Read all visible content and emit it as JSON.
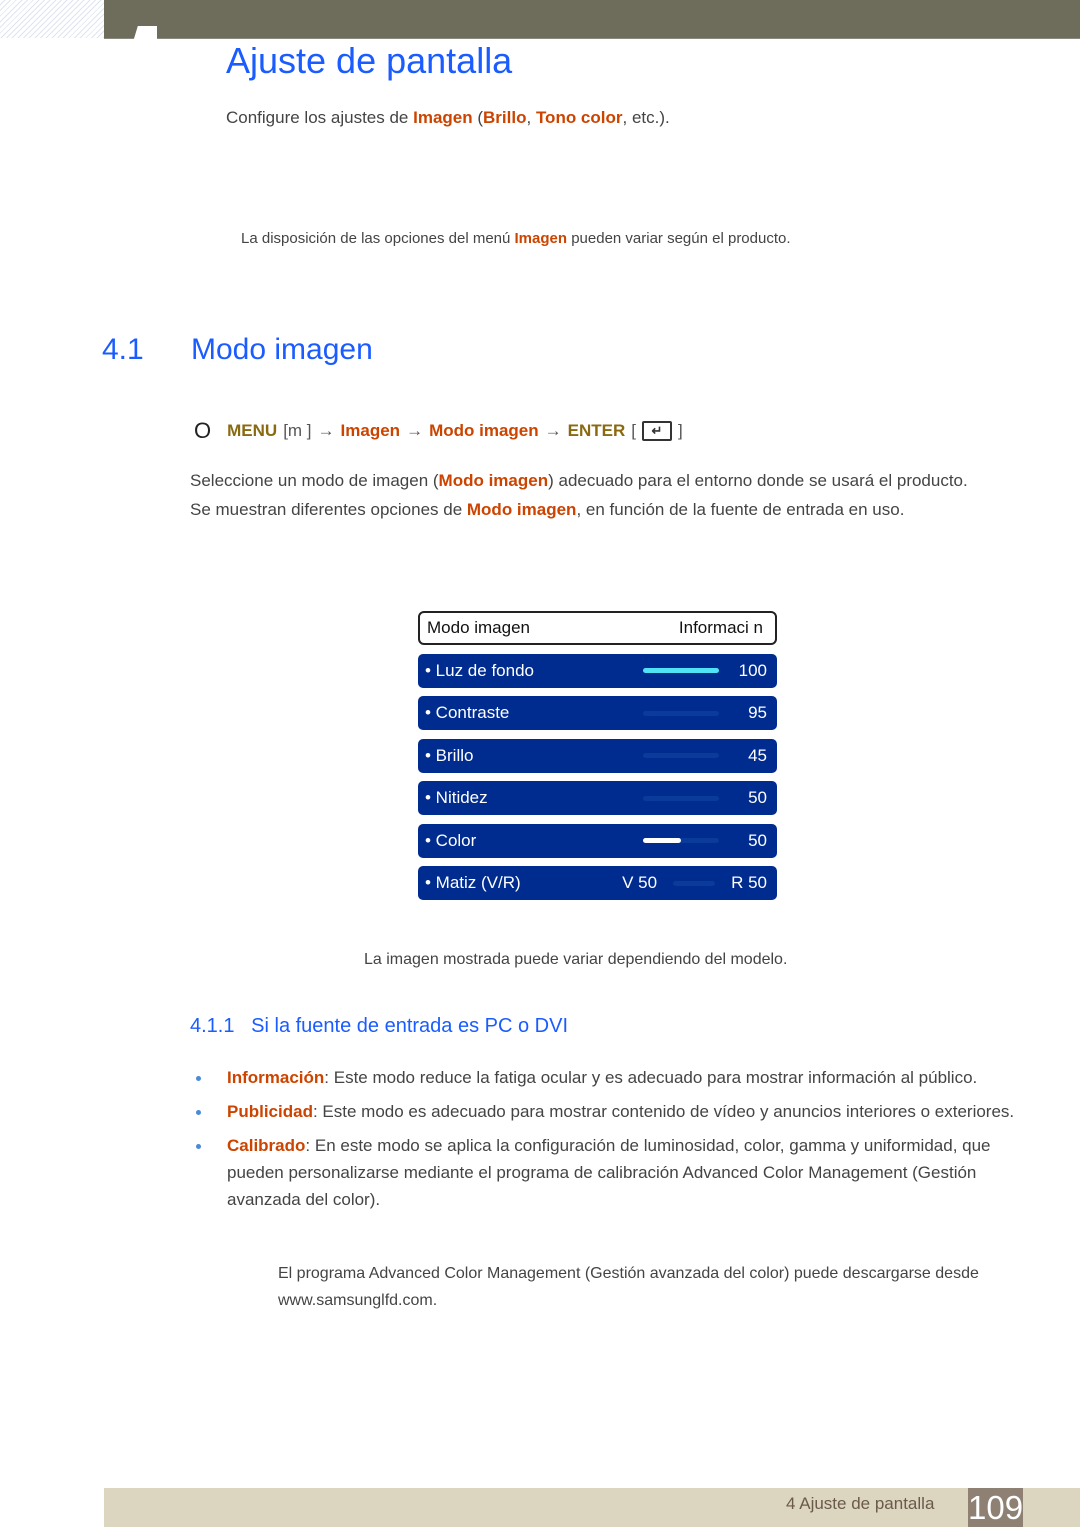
{
  "header": {
    "chapter_title": "Ajuste de pantalla"
  },
  "intro": {
    "prefix": "Configure los ajustes de ",
    "imagen": "Imagen",
    "open_paren": " (",
    "brillo": "Brillo",
    "comma": ", ",
    "tono": "Tono color",
    "suffix": ", etc.)."
  },
  "note1": {
    "prefix": "La disposición de las opciones del menú ",
    "highlight": "Imagen",
    "suffix": " pueden variar según el producto."
  },
  "section": {
    "number": "4.1",
    "title": "Modo imagen"
  },
  "menu_path": {
    "bullet": "O",
    "menu": "MENU",
    "menu_key": "[m ]",
    "arrow": "→",
    "step1": "Imagen",
    "step2": "Modo imagen",
    "enter": "ENTER",
    "enter_icon": "enter-icon"
  },
  "description": {
    "line1_prefix": "Seleccione un modo de imagen (",
    "line1_highlight": "Modo imagen",
    "line1_suffix": ") adecuado para el entorno donde se usará el producto.",
    "line2_prefix": "Se muestran diferentes opciones de ",
    "line2_highlight": "Modo imagen",
    "line2_suffix": ", en función de la fuente de entrada en uso."
  },
  "osd_menu": {
    "header_label": "Modo imagen",
    "header_value": "Informaci n",
    "items": [
      {
        "label": "• Luz de fondo",
        "value": "100",
        "level": 100
      },
      {
        "label": "• Contraste",
        "value": "95",
        "level": 0
      },
      {
        "label": "• Brillo",
        "value": "45",
        "level": 0
      },
      {
        "label": "• Nitidez",
        "value": "50",
        "level": 0
      },
      {
        "label": "• Color",
        "value": "50",
        "level": 50
      }
    ],
    "matiz": {
      "label": "• Matiz (V/R)",
      "left_value": "V 50",
      "right_value": "R 50"
    },
    "colors": {
      "row_bg": "#002b8f",
      "fill_cyan": "#4fe3f5",
      "fill_white": "#ffffff"
    }
  },
  "caption": "La imagen mostrada puede variar dependiendo del modelo.",
  "subsection": {
    "number": "4.1.1",
    "title": "Si la fuente de entrada es PC o DVI"
  },
  "bullets": [
    {
      "term": "Información",
      "text": ": Este modo reduce la fatiga ocular y es adecuado para mostrar información al público."
    },
    {
      "term": "Publicidad",
      "text": ": Este modo es adecuado para mostrar contenido de vídeo y anuncios interiores o exteriores."
    },
    {
      "term": "Calibrado",
      "text": ": En este modo se aplica la configuración de luminosidad, color, gamma y uniformidad, que pueden personalizarse mediante el programa de calibración Advanced Color Management (Gestión avanzada del color)."
    }
  ],
  "note2": "El programa Advanced Color Management (Gestión avanzada del color) puede descargarse desde www.samsunglfd.com.",
  "footer": {
    "label": "4 Ajuste de pantalla",
    "page": "109"
  }
}
